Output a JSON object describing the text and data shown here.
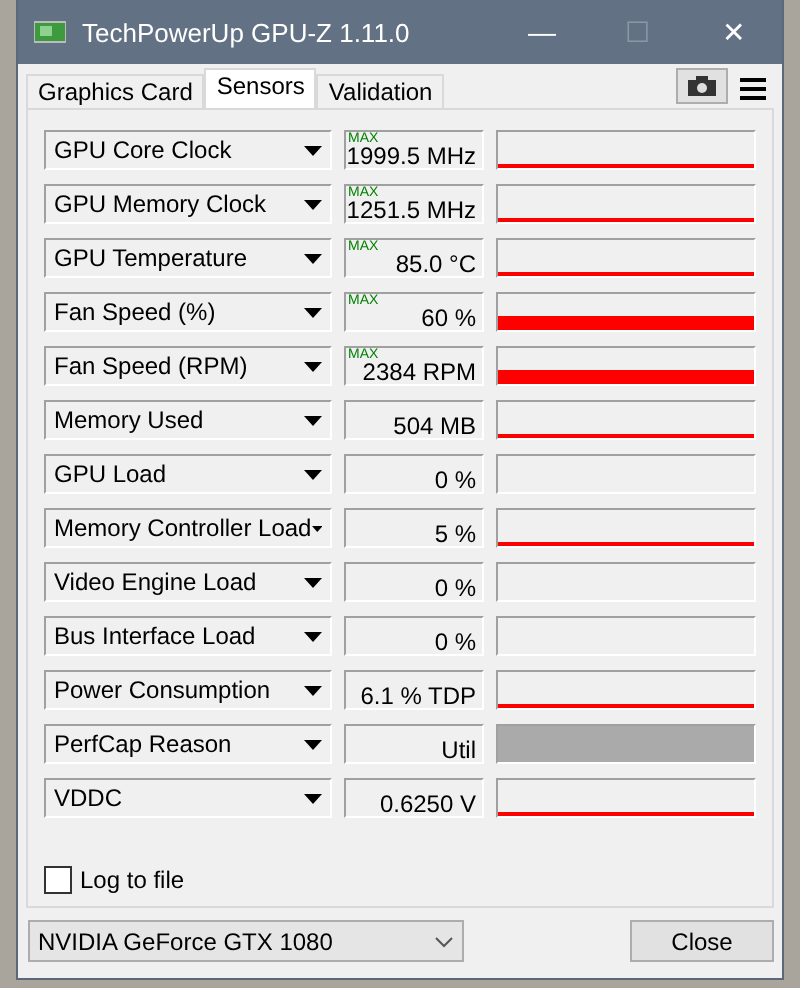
{
  "window": {
    "title": "TechPowerUp GPU-Z 1.11.0",
    "controls": [
      "—",
      "☐",
      "✕"
    ]
  },
  "tabs": [
    {
      "label": "Graphics Card",
      "selected": false
    },
    {
      "label": "Sensors",
      "selected": true
    },
    {
      "label": "Validation",
      "selected": false
    }
  ],
  "sensors": [
    {
      "name": "GPU Core Clock",
      "max_tag": "MAX",
      "value": "1999.5 MHz",
      "kind": "line"
    },
    {
      "name": "GPU Memory Clock",
      "max_tag": "MAX",
      "value": "1251.5 MHz",
      "kind": "line"
    },
    {
      "name": "GPU Temperature",
      "max_tag": "MAX",
      "value": "85.0 °C",
      "kind": "line"
    },
    {
      "name": "Fan Speed (%)",
      "max_tag": "MAX",
      "value": "60 %",
      "kind": "bar"
    },
    {
      "name": "Fan Speed (RPM)",
      "max_tag": "MAX",
      "value": "2384 RPM",
      "kind": "bar"
    },
    {
      "name": "Memory Used",
      "value": "504 MB",
      "kind": "line"
    },
    {
      "name": "GPU Load",
      "value": "0 %",
      "kind": "empty"
    },
    {
      "name": "Memory Controller Load",
      "value": "5 %",
      "kind": "line"
    },
    {
      "name": "Video Engine Load",
      "value": "0 %",
      "kind": "empty"
    },
    {
      "name": "Bus Interface Load",
      "value": "0 %",
      "kind": "empty"
    },
    {
      "name": "Power Consumption",
      "value": "6.1 % TDP",
      "kind": "line"
    },
    {
      "name": "PerfCap Reason",
      "value": "Util",
      "kind": "block"
    },
    {
      "name": "VDDC",
      "value": "0.6250 V",
      "kind": "line"
    }
  ],
  "log_to_file": {
    "label": "Log to file",
    "checked": false
  },
  "device_select": {
    "value": "NVIDIA GeForce GTX 1080"
  },
  "close_button": "Close"
}
